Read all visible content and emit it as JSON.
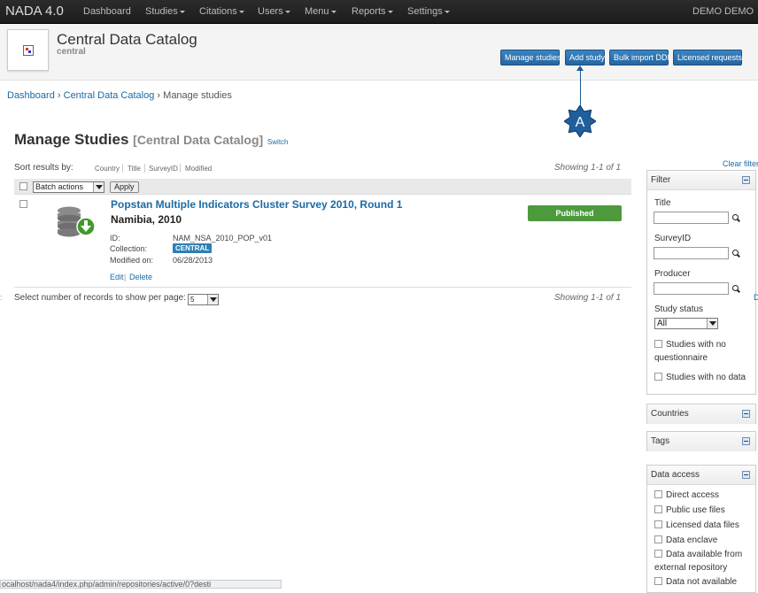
{
  "navbar": {
    "brand": "NADA 4.0",
    "items": [
      {
        "label": "Dashboard",
        "has_caret": false
      },
      {
        "label": "Studies",
        "has_caret": true
      },
      {
        "label": "Citations",
        "has_caret": true
      },
      {
        "label": "Users",
        "has_caret": true
      },
      {
        "label": "Menu",
        "has_caret": true
      },
      {
        "label": "Reports",
        "has_caret": true
      },
      {
        "label": "Settings",
        "has_caret": true
      }
    ],
    "user": "DEMO DEMO"
  },
  "header": {
    "title": "Central Data Catalog",
    "subtitle": "central",
    "buttons": [
      "Manage studies",
      "Add study",
      "Bulk import DDI",
      "Licensed requests"
    ]
  },
  "breadcrumb": {
    "items": [
      "Dashboard",
      "Central Data Catalog"
    ],
    "current": "Manage studies",
    "separator": "›"
  },
  "annotation": {
    "letter": "A",
    "color": "#1c5b96"
  },
  "page": {
    "title": "Manage Studies",
    "subtitle": "[Central Data Catalog]",
    "switch": "Switch"
  },
  "sort": {
    "label": "Sort results by:",
    "options": [
      "Country",
      "Title",
      "SurveyID",
      "Modified"
    ]
  },
  "showing": "Showing 1-1 of 1",
  "toolbar": {
    "batch_actions": "Batch actions",
    "apply": "Apply"
  },
  "study": {
    "title": "Popstan Multiple Indicators Cluster Survey 2010, Round 1",
    "country_year": "Namibia, 2010",
    "id_label": "ID:",
    "id": "NAM_NSA_2010_POP_v01",
    "collection_label": "Collection:",
    "collection": "CENTRAL",
    "modified_label": "Modified on:",
    "modified": "06/28/2013",
    "edit": "Edit",
    "delete": "Delete",
    "status": "Published"
  },
  "pagination": {
    "label": "Select number of records to show per page:",
    "value": "5"
  },
  "sidebar": {
    "clear_filter": "Clear filter",
    "filter": {
      "heading": "Filter",
      "title_label": "Title",
      "surveyid_label": "SurveyID",
      "producer_label": "Producer",
      "status_label": "Study status",
      "status_value": "All",
      "no_questionnaire": "Studies with no questionnaire",
      "no_data": "Studies with no data"
    },
    "countries": "Countries",
    "tags": "Tags",
    "data_access": {
      "heading": "Data access",
      "options": [
        "Direct access",
        "Public use files",
        "Licensed data files",
        "Data enclave",
        "Data available from external repository",
        "Data not available"
      ]
    }
  },
  "status_bar": "ocalhost/nada4/index.php/admin/repositories/active/0?desti",
  "colors": {
    "navbar": "#1c1c1c",
    "button": "#2a6fa9",
    "link": "#1a6aa6",
    "published": "#4d9a3d",
    "badge": "#2e80b5"
  }
}
